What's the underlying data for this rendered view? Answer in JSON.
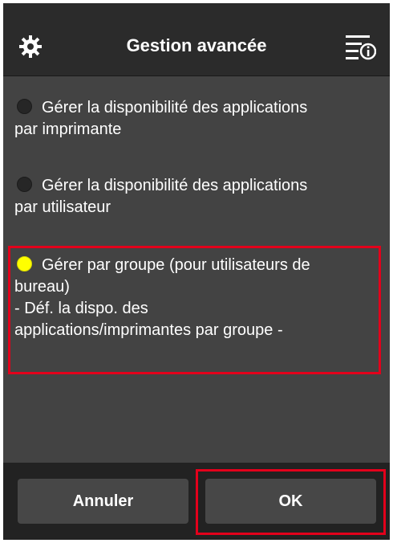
{
  "header": {
    "title": "Gestion avancée",
    "left_icon": "gear-icon",
    "right_icon": "menu-info-icon"
  },
  "options": [
    {
      "line1": "Gérer la disponibilité des applications",
      "line2": "par imprimante",
      "selected": false
    },
    {
      "line1": "Gérer la disponibilité des applications",
      "line2": "par utilisateur",
      "selected": false
    },
    {
      "line1": "Gérer par groupe (pour utilisateurs de",
      "line2": "bureau)",
      "line3": "- Déf. la dispo. des",
      "line4": "applications/imprimantes par groupe -",
      "selected": true
    }
  ],
  "footer": {
    "cancel_label": "Annuler",
    "ok_label": "OK"
  },
  "colors": {
    "highlight": "#e3001b",
    "selected_radio": "#ffff00",
    "background": "#434343"
  }
}
